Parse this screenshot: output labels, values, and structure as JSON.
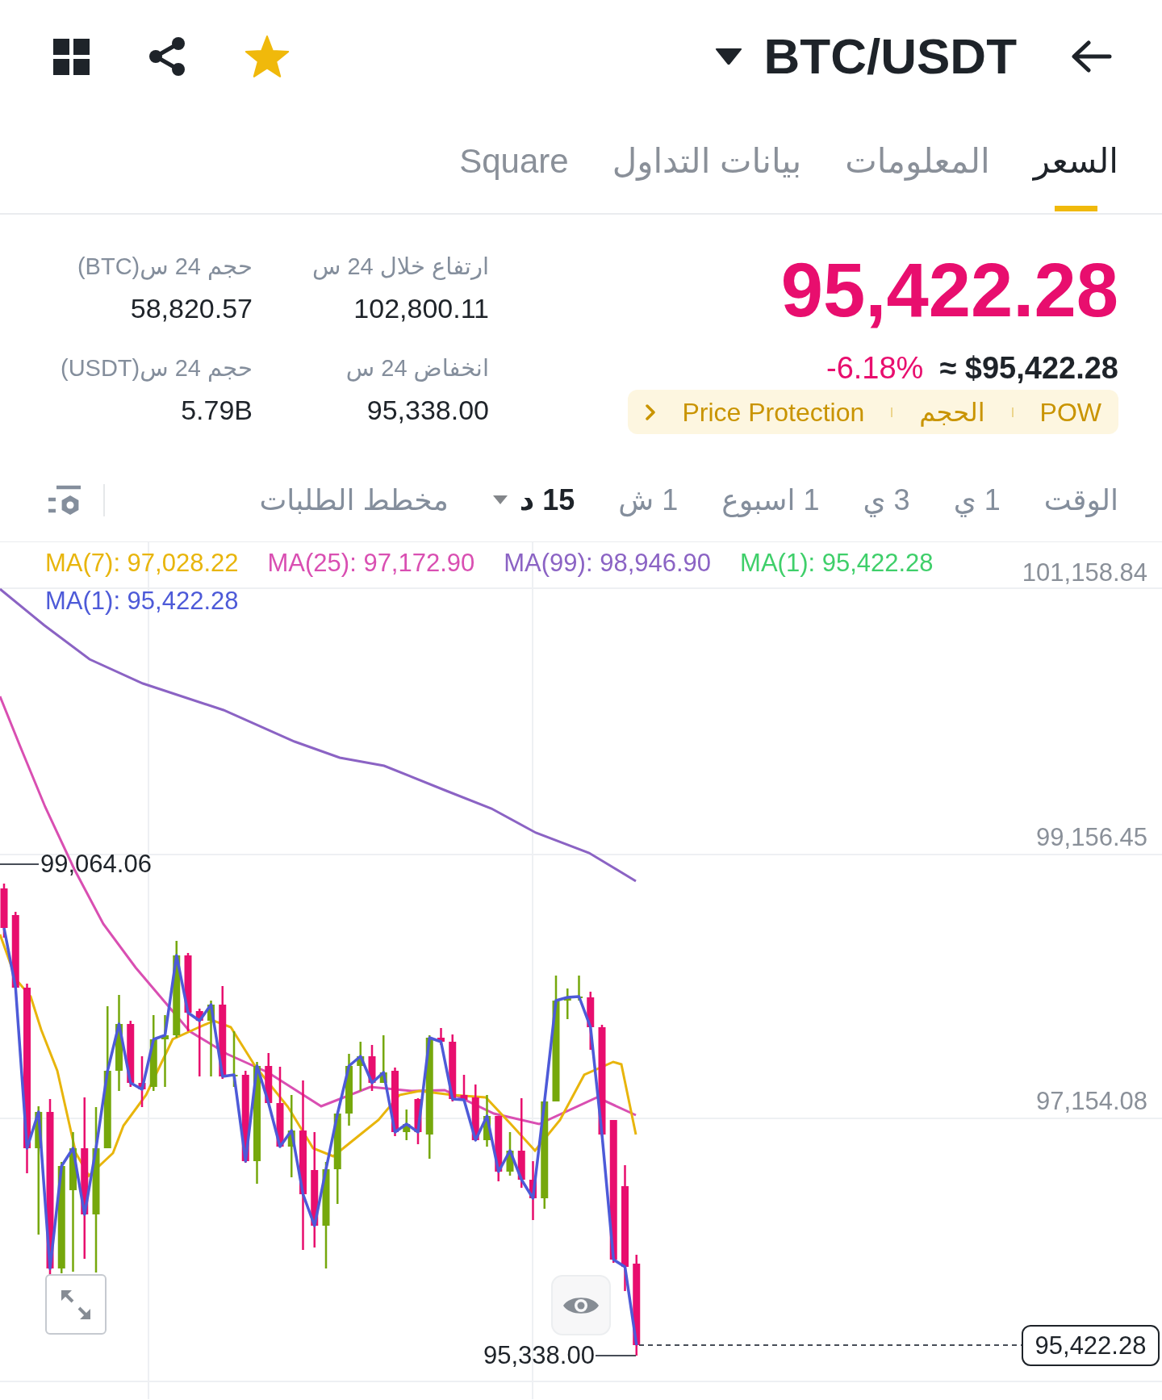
{
  "header": {
    "pair": "BTC/USDT",
    "favorite": true
  },
  "tabs": [
    {
      "label": "السعر",
      "selected": true
    },
    {
      "label": "المعلومات",
      "selected": false
    },
    {
      "label": "بيانات التداول",
      "selected": false
    },
    {
      "label": "Square",
      "selected": false
    }
  ],
  "price": {
    "last": "95,422.28",
    "change": "-6.18%",
    "approx": "≈ $95,422.28",
    "tags": [
      "POW",
      "الحجم",
      "Price Protection"
    ]
  },
  "stats": [
    {
      "items": [
        {
          "label": "ارتفاع خلال 24 س",
          "value": "102,800.11"
        },
        {
          "label": "انخفاض 24 س",
          "value": "95,338.00"
        }
      ]
    },
    {
      "items": [
        {
          "label": "حجم 24 س(BTC)",
          "value": "58,820.57"
        },
        {
          "label": "حجم 24 س(USDT)",
          "value": "5.79B"
        }
      ]
    }
  ],
  "intervals": [
    {
      "label": "الوقت",
      "kind": "option",
      "selected": false
    },
    {
      "label": "1 ي",
      "kind": "option",
      "selected": false
    },
    {
      "label": "3 ي",
      "kind": "option",
      "selected": false
    },
    {
      "label": "1 اسبوع",
      "kind": "option",
      "selected": false
    },
    {
      "label": "1 ش",
      "kind": "option",
      "selected": false
    },
    {
      "label": "15 د",
      "kind": "dropdown",
      "selected": true
    },
    {
      "label": "مخطط الطلبات",
      "kind": "option",
      "selected": false
    }
  ],
  "chart": {
    "legend": [
      {
        "items": [
          {
            "label": "MA(1): 95,422.28",
            "color": "#3fcf6a"
          },
          {
            "label": "MA(99): 98,946.90",
            "color": "#8b63c4"
          },
          {
            "label": "MA(25): 97,172.90",
            "color": "#d94fb2"
          },
          {
            "label": "MA(7): 97,028.22",
            "color": "#e8b50c"
          }
        ]
      },
      {
        "items": [
          {
            "label": "MA(1): 95,422.28",
            "color": "#4d5ad8"
          }
        ]
      }
    ],
    "axis_labels": [
      "101,158.84",
      "99,156.45",
      "97,154.08"
    ],
    "high_label": "99,064.06",
    "low_label": "95,338.00",
    "last_price": "95,422.28"
  }
}
